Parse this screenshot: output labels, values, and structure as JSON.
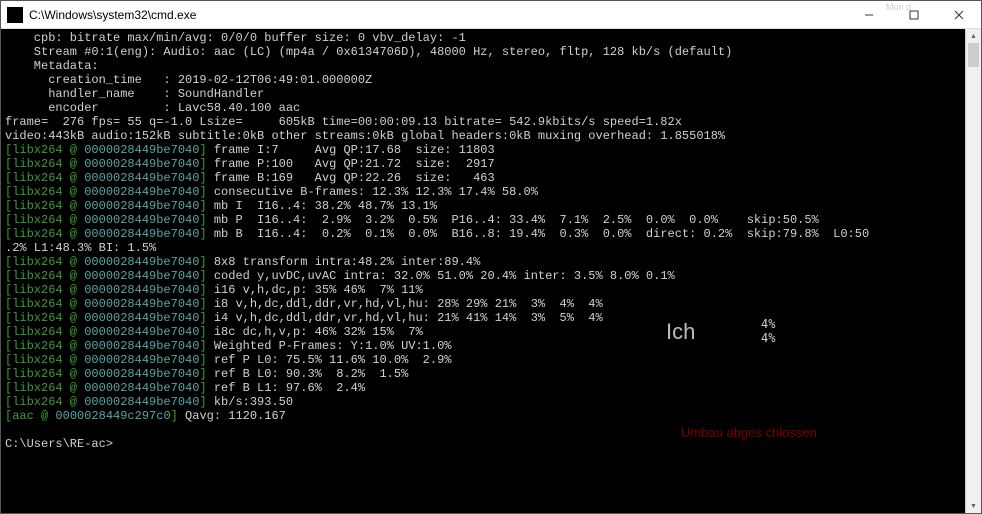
{
  "titlebar": {
    "title": "C:\\Windows\\system32\\cmd.exe",
    "watermark": "Mun\nd"
  },
  "lines": [
    {
      "segs": [
        {
          "c": "c-white",
          "t": "    cpb: bitrate max/min/avg: 0/0/0 buffer size: 0 vbv_delay: -1"
        }
      ]
    },
    {
      "segs": [
        {
          "c": "c-white",
          "t": "    Stream #0:1(eng): Audio: aac (LC) (mp4a / 0x6134706D), 48000 Hz, stereo, fltp, 128 kb/s (default)"
        }
      ]
    },
    {
      "segs": [
        {
          "c": "c-white",
          "t": "    Metadata:"
        }
      ]
    },
    {
      "segs": [
        {
          "c": "c-white",
          "t": "      creation_time   : 2019-02-12T06:49:01.000000Z"
        }
      ]
    },
    {
      "segs": [
        {
          "c": "c-white",
          "t": "      handler_name    : SoundHandler"
        }
      ]
    },
    {
      "segs": [
        {
          "c": "c-white",
          "t": "      encoder         : Lavc58.40.100 aac"
        }
      ]
    },
    {
      "segs": [
        {
          "c": "c-white",
          "t": "frame=  276 fps= 55 q=-1.0 Lsize=     605kB time=00:00:09.13 bitrate= 542.9kbits/s speed=1.82x"
        }
      ]
    },
    {
      "segs": [
        {
          "c": "c-white",
          "t": "video:443kB audio:152kB subtitle:0kB other streams:0kB global headers:0kB muxing overhead: 1.855018%"
        }
      ]
    },
    {
      "segs": [
        {
          "c": "c-green",
          "t": "[libx264 @ "
        },
        {
          "c": "c-cyan",
          "t": "0000028449be7040"
        },
        {
          "c": "c-green",
          "t": "] "
        },
        {
          "c": "c-white",
          "t": "frame I:7     Avg QP:17.68  size: 11803"
        }
      ]
    },
    {
      "segs": [
        {
          "c": "c-green",
          "t": "[libx264 @ "
        },
        {
          "c": "c-cyan",
          "t": "0000028449be7040"
        },
        {
          "c": "c-green",
          "t": "] "
        },
        {
          "c": "c-white",
          "t": "frame P:100   Avg QP:21.72  size:  2917"
        }
      ]
    },
    {
      "segs": [
        {
          "c": "c-green",
          "t": "[libx264 @ "
        },
        {
          "c": "c-cyan",
          "t": "0000028449be7040"
        },
        {
          "c": "c-green",
          "t": "] "
        },
        {
          "c": "c-white",
          "t": "frame B:169   Avg QP:22.26  size:   463"
        }
      ]
    },
    {
      "segs": [
        {
          "c": "c-green",
          "t": "[libx264 @ "
        },
        {
          "c": "c-cyan",
          "t": "0000028449be7040"
        },
        {
          "c": "c-green",
          "t": "] "
        },
        {
          "c": "c-white",
          "t": "consecutive B-frames: 12.3% 12.3% 17.4% 58.0%"
        }
      ]
    },
    {
      "segs": [
        {
          "c": "c-green",
          "t": "[libx264 @ "
        },
        {
          "c": "c-cyan",
          "t": "0000028449be7040"
        },
        {
          "c": "c-green",
          "t": "] "
        },
        {
          "c": "c-white",
          "t": "mb I  I16..4: 38.2% 48.7% 13.1%"
        }
      ]
    },
    {
      "segs": [
        {
          "c": "c-green",
          "t": "[libx264 @ "
        },
        {
          "c": "c-cyan",
          "t": "0000028449be7040"
        },
        {
          "c": "c-green",
          "t": "] "
        },
        {
          "c": "c-white",
          "t": "mb P  I16..4:  2.9%  3.2%  0.5%  P16..4: 33.4%  7.1%  2.5%  0.0%  0.0%    skip:50.5%"
        }
      ]
    },
    {
      "segs": [
        {
          "c": "c-green",
          "t": "[libx264 @ "
        },
        {
          "c": "c-cyan",
          "t": "0000028449be7040"
        },
        {
          "c": "c-green",
          "t": "] "
        },
        {
          "c": "c-white",
          "t": "mb B  I16..4:  0.2%  0.1%  0.0%  B16..8: 19.4%  0.3%  0.0%  direct: 0.2%  skip:79.8%  L0:50"
        }
      ]
    },
    {
      "segs": [
        {
          "c": "c-white",
          "t": ".2% L1:48.3% BI: 1.5%"
        }
      ]
    },
    {
      "segs": [
        {
          "c": "c-green",
          "t": "[libx264 @ "
        },
        {
          "c": "c-cyan",
          "t": "0000028449be7040"
        },
        {
          "c": "c-green",
          "t": "] "
        },
        {
          "c": "c-white",
          "t": "8x8 transform intra:48.2% inter:89.4%"
        }
      ]
    },
    {
      "segs": [
        {
          "c": "c-green",
          "t": "[libx264 @ "
        },
        {
          "c": "c-cyan",
          "t": "0000028449be7040"
        },
        {
          "c": "c-green",
          "t": "] "
        },
        {
          "c": "c-white",
          "t": "coded y,uvDC,uvAC intra: 32.0% 51.0% 20.4% inter: 3.5% 8.0% 0.1%"
        }
      ]
    },
    {
      "segs": [
        {
          "c": "c-green",
          "t": "[libx264 @ "
        },
        {
          "c": "c-cyan",
          "t": "0000028449be7040"
        },
        {
          "c": "c-green",
          "t": "] "
        },
        {
          "c": "c-white",
          "t": "i16 v,h,dc,p: 35% 46%  7% 11%"
        }
      ]
    },
    {
      "segs": [
        {
          "c": "c-green",
          "t": "[libx264 @ "
        },
        {
          "c": "c-cyan",
          "t": "0000028449be7040"
        },
        {
          "c": "c-green",
          "t": "] "
        },
        {
          "c": "c-white",
          "t": "i8 v,h,dc,ddl,ddr,vr,hd,vl,hu: 28% 29% 21%  3%  4%  4%"
        }
      ]
    },
    {
      "segs": [
        {
          "c": "c-green",
          "t": "[libx264 @ "
        },
        {
          "c": "c-cyan",
          "t": "0000028449be7040"
        },
        {
          "c": "c-green",
          "t": "] "
        },
        {
          "c": "c-white",
          "t": "i4 v,h,dc,ddl,ddr,vr,hd,vl,hu: 21% 41% 14%  3%  5%  4%"
        }
      ]
    },
    {
      "segs": [
        {
          "c": "c-green",
          "t": "[libx264 @ "
        },
        {
          "c": "c-cyan",
          "t": "0000028449be7040"
        },
        {
          "c": "c-green",
          "t": "] "
        },
        {
          "c": "c-white",
          "t": "i8c dc,h,v,p: 46% 32% 15%  7%"
        }
      ]
    },
    {
      "segs": [
        {
          "c": "c-green",
          "t": "[libx264 @ "
        },
        {
          "c": "c-cyan",
          "t": "0000028449be7040"
        },
        {
          "c": "c-green",
          "t": "] "
        },
        {
          "c": "c-white",
          "t": "Weighted P-Frames: Y:1.0% UV:1.0%"
        }
      ]
    },
    {
      "segs": [
        {
          "c": "c-green",
          "t": "[libx264 @ "
        },
        {
          "c": "c-cyan",
          "t": "0000028449be7040"
        },
        {
          "c": "c-green",
          "t": "] "
        },
        {
          "c": "c-white",
          "t": "ref P L0: 75.5% 11.6% 10.0%  2.9%"
        }
      ]
    },
    {
      "segs": [
        {
          "c": "c-green",
          "t": "[libx264 @ "
        },
        {
          "c": "c-cyan",
          "t": "0000028449be7040"
        },
        {
          "c": "c-green",
          "t": "] "
        },
        {
          "c": "c-white",
          "t": "ref B L0: 90.3%  8.2%  1.5%"
        }
      ]
    },
    {
      "segs": [
        {
          "c": "c-green",
          "t": "[libx264 @ "
        },
        {
          "c": "c-cyan",
          "t": "0000028449be7040"
        },
        {
          "c": "c-green",
          "t": "] "
        },
        {
          "c": "c-white",
          "t": "ref B L1: 97.6%  2.4%"
        }
      ]
    },
    {
      "segs": [
        {
          "c": "c-green",
          "t": "[libx264 @ "
        },
        {
          "c": "c-cyan",
          "t": "0000028449be7040"
        },
        {
          "c": "c-green",
          "t": "] "
        },
        {
          "c": "c-white",
          "t": "kb/s:393.50"
        }
      ]
    },
    {
      "segs": [
        {
          "c": "c-green",
          "t": "[aac @ "
        },
        {
          "c": "c-cyan",
          "t": "0000028449c297c0"
        },
        {
          "c": "c-green",
          "t": "] "
        },
        {
          "c": "c-white",
          "t": "Qavg: 1120.167"
        }
      ]
    },
    {
      "segs": [
        {
          "c": "c-white",
          "t": ""
        }
      ]
    },
    {
      "segs": [
        {
          "c": "c-white",
          "t": "C:\\Users\\RE-ac>"
        }
      ]
    }
  ],
  "annotations": {
    "ich": "Ich",
    "fourA": "4%",
    "fourB": "4%",
    "umbau": "Umbau abges\nchlossen"
  }
}
